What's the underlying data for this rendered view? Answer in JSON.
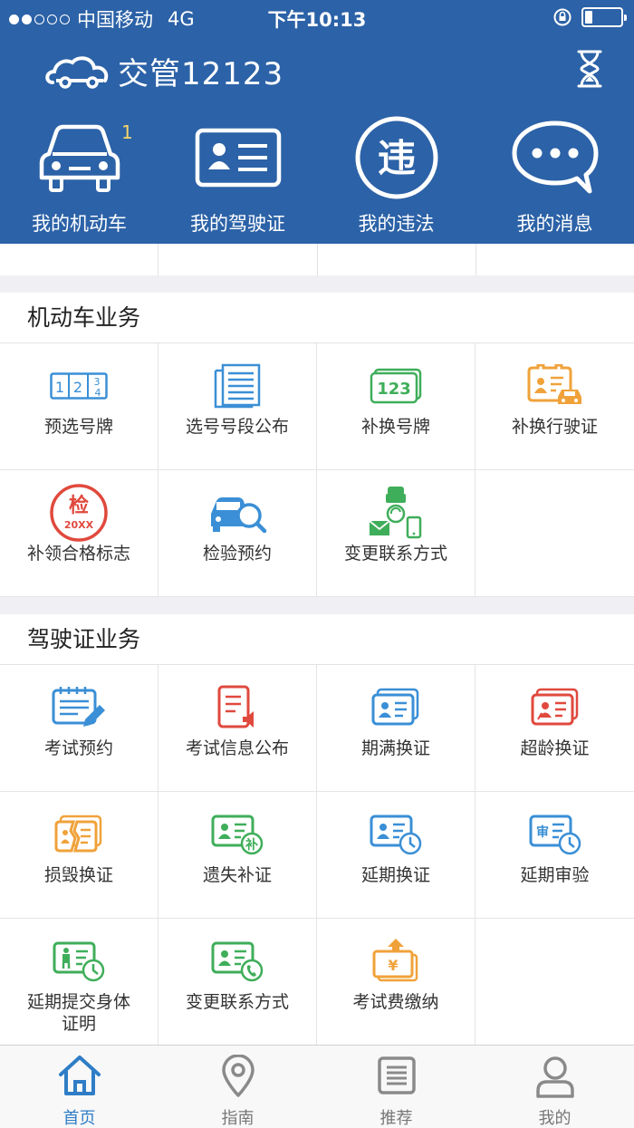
{
  "status_bar": {
    "carrier": "中国移动",
    "network": "4G",
    "time": "下午10:13",
    "signal_dots_filled": 2,
    "signal_dots_total": 5,
    "battery_level": 0.2
  },
  "header": {
    "app_name": "交管12123",
    "logo_icon": "car-cloud-icon",
    "history_icon": "hourglass-icon"
  },
  "quick_actions": [
    {
      "label": "我的机动车",
      "icon": "car-icon",
      "badge": "1"
    },
    {
      "label": "我的驾驶证",
      "icon": "license-card-icon"
    },
    {
      "label": "我的违法",
      "icon": "violation-icon",
      "icon_text": "违"
    },
    {
      "label": "我的消息",
      "icon": "message-icon"
    }
  ],
  "vehicle_section": {
    "title": "机动车业务",
    "items": [
      {
        "label": "预选号牌",
        "icon": "plate-select-icon"
      },
      {
        "label": "选号号段公布",
        "icon": "number-list-icon"
      },
      {
        "label": "补换号牌",
        "icon": "plate-replace-icon",
        "icon_text": "123"
      },
      {
        "label": "补换行驶证",
        "icon": "vehicle-license-icon"
      },
      {
        "label": "补领合格标志",
        "icon": "inspection-mark-icon",
        "icon_text": "检",
        "icon_subtext": "20XX"
      },
      {
        "label": "检验预约",
        "icon": "inspection-booking-icon"
      },
      {
        "label": "变更联系方式",
        "icon": "contact-change-icon"
      }
    ]
  },
  "license_section": {
    "title": "驾驶证业务",
    "items": [
      {
        "label": "考试预约",
        "icon": "exam-booking-icon"
      },
      {
        "label": "考试信息公布",
        "icon": "exam-notice-icon"
      },
      {
        "label": "期满换证",
        "icon": "expiry-renew-icon"
      },
      {
        "label": "超龄换证",
        "icon": "overage-renew-icon"
      },
      {
        "label": "损毁换证",
        "icon": "damaged-renew-icon"
      },
      {
        "label": "遗失补证",
        "icon": "lost-reissue-icon",
        "icon_text": "补"
      },
      {
        "label": "延期换证",
        "icon": "deferred-renew-icon"
      },
      {
        "label": "延期审验",
        "icon": "deferred-review-icon",
        "icon_text": "审"
      },
      {
        "label": "延期提交身体证明",
        "icon": "deferred-health-icon"
      },
      {
        "label": "变更联系方式",
        "icon": "license-contact-change-icon"
      },
      {
        "label": "考试费缴纳",
        "icon": "exam-fee-icon",
        "icon_text": "¥"
      }
    ]
  },
  "tab_bar": {
    "tabs": [
      {
        "label": "首页",
        "icon": "home-icon",
        "active": true
      },
      {
        "label": "指南",
        "icon": "location-pin-icon",
        "active": false
      },
      {
        "label": "推荐",
        "icon": "list-doc-icon",
        "active": false
      },
      {
        "label": "我的",
        "icon": "user-icon",
        "active": false
      }
    ]
  },
  "colors": {
    "header_blue": "#2c62a7",
    "active_tab": "#2f7dc6",
    "icon_blue": "#3a8fd6",
    "icon_green": "#3fae5a",
    "icon_orange": "#f0a23a",
    "icon_red": "#e0493d"
  }
}
